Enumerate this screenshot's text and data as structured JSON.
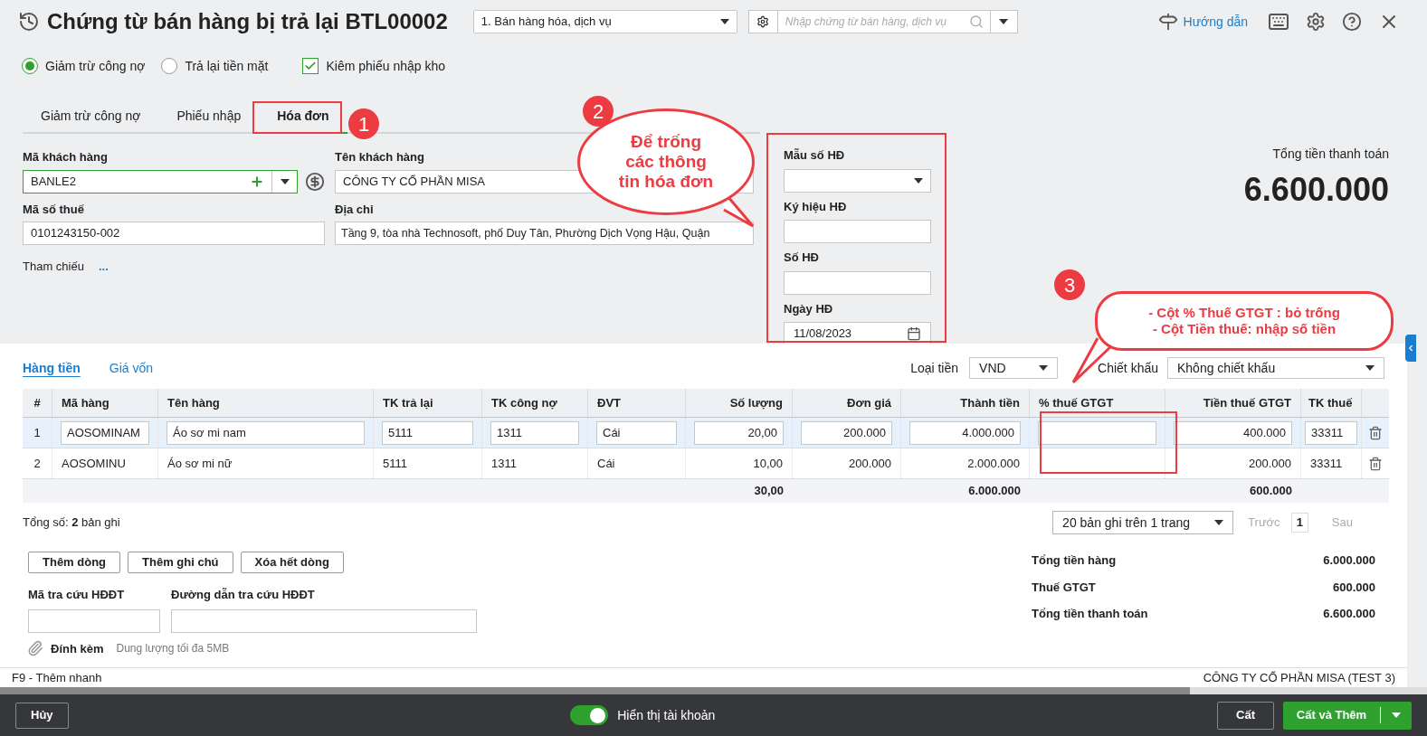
{
  "header": {
    "title": "Chứng từ bán hàng bị trả lại BTL00002",
    "type_select": "1. Bán hàng hóa, dịch vụ",
    "search": {
      "placeholder": "Nhập chứng từ bán hàng, dịch vụ"
    },
    "guide_link": "Hướng dẫn"
  },
  "options": [
    {
      "kind": "radio",
      "label": "Giảm trừ công nợ",
      "selected": true
    },
    {
      "kind": "radio",
      "label": "Trả lại tiền mặt",
      "selected": false
    },
    {
      "kind": "checkbox",
      "label": "Kiêm phiếu nhập kho",
      "checked": true
    }
  ],
  "tabs": [
    {
      "label": "Giảm trừ công nợ",
      "selected": false
    },
    {
      "label": "Phiếu nhập",
      "selected": false
    },
    {
      "label": "Hóa đơn",
      "selected": true
    }
  ],
  "customer": {
    "code_label": "Mã khách hàng",
    "code": "BANLE2",
    "name_label": "Tên khách hàng",
    "name": "CÔNG TY CỔ PHẦN MISA",
    "tax_label": "Mã số thuế",
    "tax": "0101243150-002",
    "address_label": "Địa chỉ",
    "address": "Tầng 9, tòa nhà Technosoft, phố Duy Tân, Phường Dịch Vọng Hậu, Quận",
    "reference_label": "Tham chiếu",
    "reference_more": "..."
  },
  "invoice": [
    {
      "kind": "select",
      "label": "Mẫu số HĐ"
    },
    {
      "kind": "text",
      "label": "Ký hiệu HĐ"
    },
    {
      "kind": "text",
      "label": "Số HĐ"
    },
    {
      "kind": "date",
      "label": "Ngày HĐ",
      "value": "11/08/2023"
    }
  ],
  "total": {
    "label": "Tổng tiền thanh toán",
    "value": "6.600.000"
  },
  "detail_tabs": [
    {
      "label": "Hàng tiền",
      "selected": true
    },
    {
      "label": "Giá vốn",
      "selected": false
    }
  ],
  "currency": {
    "label": "Loại tiền",
    "value": "VND"
  },
  "discount": {
    "label": "Chiết khấu",
    "value": "Không chiết khấu"
  },
  "table": {
    "columns": [
      "#",
      "Mã hàng",
      "Tên hàng",
      "TK trả lại",
      "TK công nợ",
      "ĐVT",
      "Số lượng",
      "Đơn giá",
      "Thành tiền",
      "% thuế GTGT",
      "Tiền thuế GTGT",
      "TK thuế"
    ],
    "rows": [
      {
        "selected": true,
        "no": "1",
        "code": "AOSOMINAM",
        "name": "Áo sơ mi nam",
        "return_account": "5111",
        "debt_account": "1311",
        "unit": "Cái",
        "quantity": "20,00",
        "price": "200.000",
        "amount": "4.000.000",
        "tax_amount": "400.000",
        "tax_account": "33311"
      },
      {
        "selected": false,
        "no": "2",
        "code": "AOSOMINU",
        "name": "Áo sơ mi nữ",
        "return_account": "5111",
        "debt_account": "1311",
        "unit": "Cái",
        "quantity": "10,00",
        "price": "200.000",
        "amount": "2.000.000",
        "tax_amount": "200.000",
        "tax_account": "33311"
      }
    ],
    "totals": {
      "quantity": "30,00",
      "amount": "6.000.000",
      "tax_amount": "600.000"
    }
  },
  "record_count": "Tổng số: **2** bản ghi",
  "pagination": {
    "page_size": "20 bản ghi trên 1 trang",
    "prev": "Trước",
    "page": "1",
    "next": "Sau"
  },
  "actions": [
    "Thêm dòng",
    "Thêm ghi chú",
    "Xóa hết dòng"
  ],
  "einvoice": {
    "code_label": "Mã tra cứu HĐĐT",
    "url_label": "Đường dẫn tra cứu HĐĐT"
  },
  "attachment": {
    "label": "Đính kèm",
    "hint": "Dung lượng tối đa 5MB"
  },
  "summary": [
    {
      "label": "Tổng tiền hàng",
      "value": "6.000.000"
    },
    {
      "label": "Thuế GTGT",
      "value": "600.000"
    },
    {
      "label": "Tổng tiền thanh toán",
      "value": "6.600.000"
    }
  ],
  "status_bar": {
    "shortcut": "F9 - Thêm nhanh",
    "company": "CÔNG TY CỔ PHẦN MISA (TEST 3)"
  },
  "footer": {
    "cancel": "Hủy",
    "toggle": {
      "label": "Hiển thị tài khoản",
      "on": true
    },
    "save": "Cất",
    "save_add": "Cất và Thêm"
  },
  "annotations": [
    {
      "number": "1"
    },
    {
      "number": "2",
      "text": "Để trống các thông tin hóa đơn"
    },
    {
      "number": "3",
      "lines": [
        "- Cột % Thuế GTGT : bỏ trống",
        "- Cột Tiền thuế: nhập số tiền"
      ]
    }
  ]
}
